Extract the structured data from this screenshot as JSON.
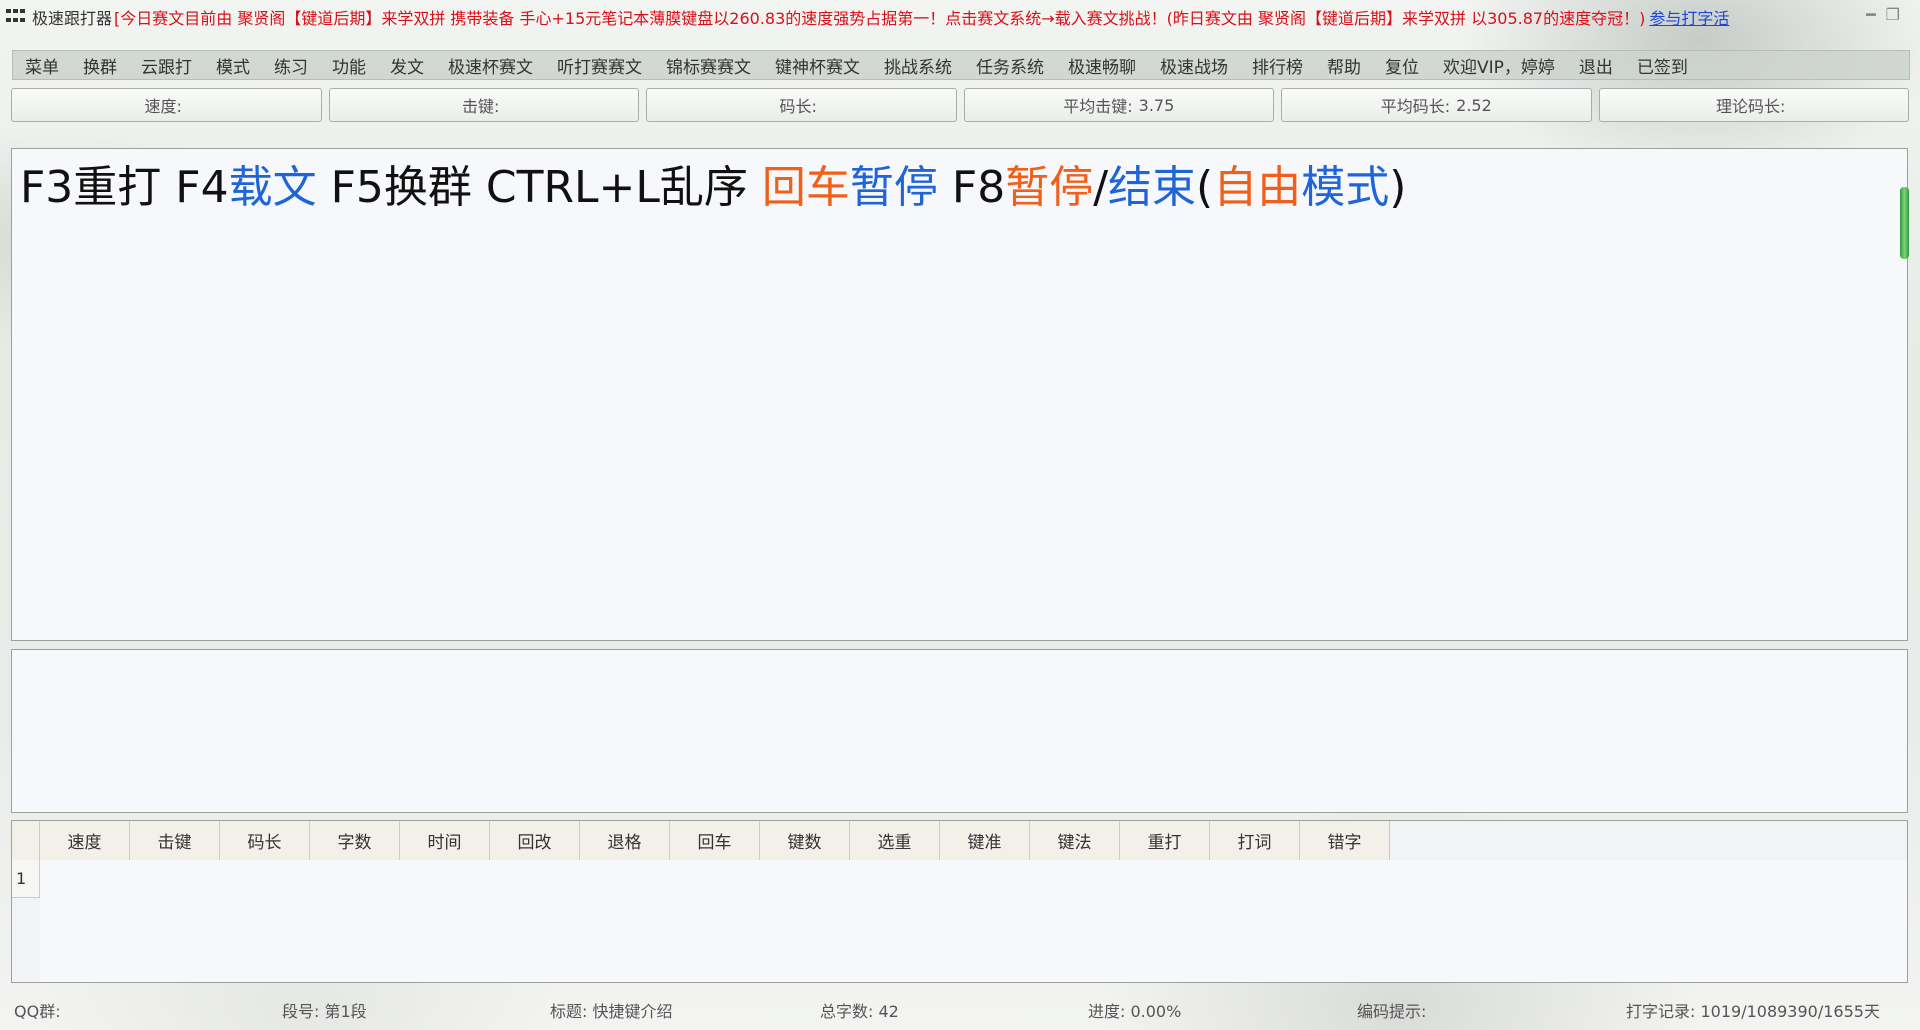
{
  "title": {
    "app_name": "极速跟打器",
    "notice": "[今日赛文目前由 聚贤阁【键道后期】来学双拼 携带装备 手心+15元笔记本薄膜键盘以260.83的速度强势占据第一！点击赛文系统→载入赛文挑战！(昨日赛文由 聚贤阁【键道后期】来学双拼 以305.87的速度夺冠！)",
    "link": "参与打字活"
  },
  "menu": [
    "菜单",
    "换群",
    "云跟打",
    "模式",
    "练习",
    "功能",
    "发文",
    "极速杯赛文",
    "听打赛赛文",
    "锦标赛赛文",
    "键神杯赛文",
    "挑战系统",
    "任务系统",
    "极速畅聊",
    "极速战场",
    "排行榜",
    "帮助",
    "复位",
    "欢迎VIP，婷婷",
    "退出",
    "已签到"
  ],
  "stats": [
    {
      "label": "速度:",
      "value": ""
    },
    {
      "label": "击键:",
      "value": ""
    },
    {
      "label": "码长:",
      "value": ""
    },
    {
      "label": "平均击键:",
      "value": "3.75"
    },
    {
      "label": "平均码长:",
      "value": "2.52"
    },
    {
      "label": "理论码长:",
      "value": ""
    }
  ],
  "prompt_segments": [
    {
      "text": "F3重打 F4",
      "color": "black"
    },
    {
      "text": "载文",
      "color": "blue"
    },
    {
      "text": " F5换群 CTRL+L乱序 ",
      "color": "black"
    },
    {
      "text": "回车",
      "color": "orange"
    },
    {
      "text": "暂停",
      "color": "blue"
    },
    {
      "text": " F8",
      "color": "black"
    },
    {
      "text": "暂停",
      "color": "orange"
    },
    {
      "text": "/",
      "color": "black"
    },
    {
      "text": "结束",
      "color": "blue"
    },
    {
      "text": "(",
      "color": "black"
    },
    {
      "text": "自由",
      "color": "orange"
    },
    {
      "text": "模式",
      "color": "blue"
    },
    {
      "text": ")",
      "color": "black"
    }
  ],
  "table": {
    "headers": [
      "速度",
      "击键",
      "码长",
      "字数",
      "时间",
      "回改",
      "退格",
      "回车",
      "键数",
      "选重",
      "键准",
      "键法",
      "重打",
      "打词",
      "错字"
    ],
    "row_index": "1"
  },
  "status": {
    "qq_group": "QQ群:",
    "segment": "段号: 第1段",
    "title": "标题: 快捷键介绍",
    "total_chars": "总字数: 42",
    "progress": "进度: 0.00%",
    "code_hint": "编码提示:",
    "record": "打字记录: 1019/1089390/1655天"
  },
  "colors": {
    "black": "#111111",
    "blue": "#1f64d8",
    "orange": "#f0601a",
    "notice": "#d8101a"
  }
}
